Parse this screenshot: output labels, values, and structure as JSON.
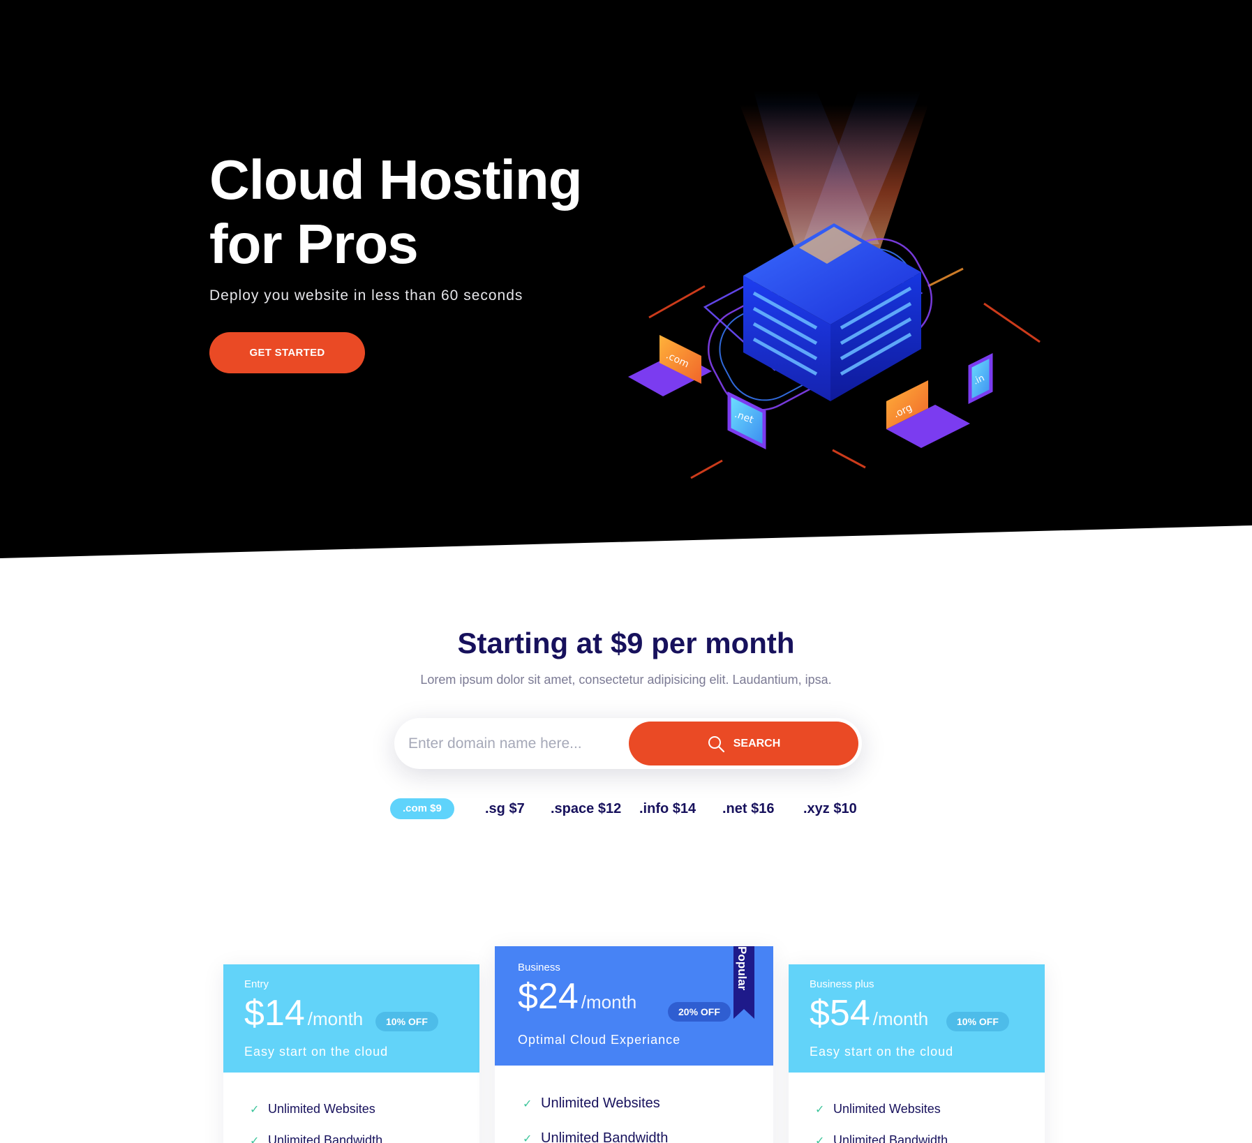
{
  "hero": {
    "title_line1": "Cloud Hosting",
    "title_line2": "for Pros",
    "subtitle": "Deploy you website in less than 60 seconds",
    "cta_label": "GET STARTED",
    "illustration_labels": [
      ".com",
      ".net",
      ".org",
      ".in"
    ]
  },
  "pricing_intro": {
    "title": "Starting at $9 per month",
    "subtitle": "Lorem ipsum dolor sit amet, consectetur adipisicing elit. Laudantium, ipsa."
  },
  "search": {
    "placeholder": "Enter domain name here...",
    "button_label": "SEARCH",
    "button_icon": "search-icon"
  },
  "domains": [
    {
      "label": ".com $9",
      "active": true
    },
    {
      "label": ".sg $7",
      "active": false
    },
    {
      "label": ".space $12",
      "active": false
    },
    {
      "label": ".info $14",
      "active": false
    },
    {
      "label": ".net $16",
      "active": false
    },
    {
      "label": ".xyz $10",
      "active": false
    }
  ],
  "plans": [
    {
      "name": "Entry",
      "price": "$14",
      "period": "/month",
      "discount": "10% OFF",
      "tagline": "Easy start on the cloud",
      "color": "#62d3f9",
      "features": [
        "Unlimited Websites",
        "Unlimited Bandwidth"
      ]
    },
    {
      "name": "Business",
      "price": "$24",
      "period": "/month",
      "discount": "20% OFF",
      "tagline": "Optimal Cloud Experiance",
      "ribbon": "Popular",
      "color": "#4783f5",
      "features": [
        "Unlimited Websites",
        "Unlimited Bandwidth"
      ]
    },
    {
      "name": "Business plus",
      "price": "$54",
      "period": "/month",
      "discount": "10% OFF",
      "tagline": "Easy start on the cloud",
      "color": "#62d3f9",
      "features": [
        "Unlimited Websites",
        "Unlimited Bandwidth"
      ]
    }
  ],
  "colors": {
    "accent": "#ea4a25",
    "navy_text": "#17115c",
    "cyan": "#62d3f9",
    "blue": "#4783f5",
    "ribbon": "#1e1a8a"
  }
}
